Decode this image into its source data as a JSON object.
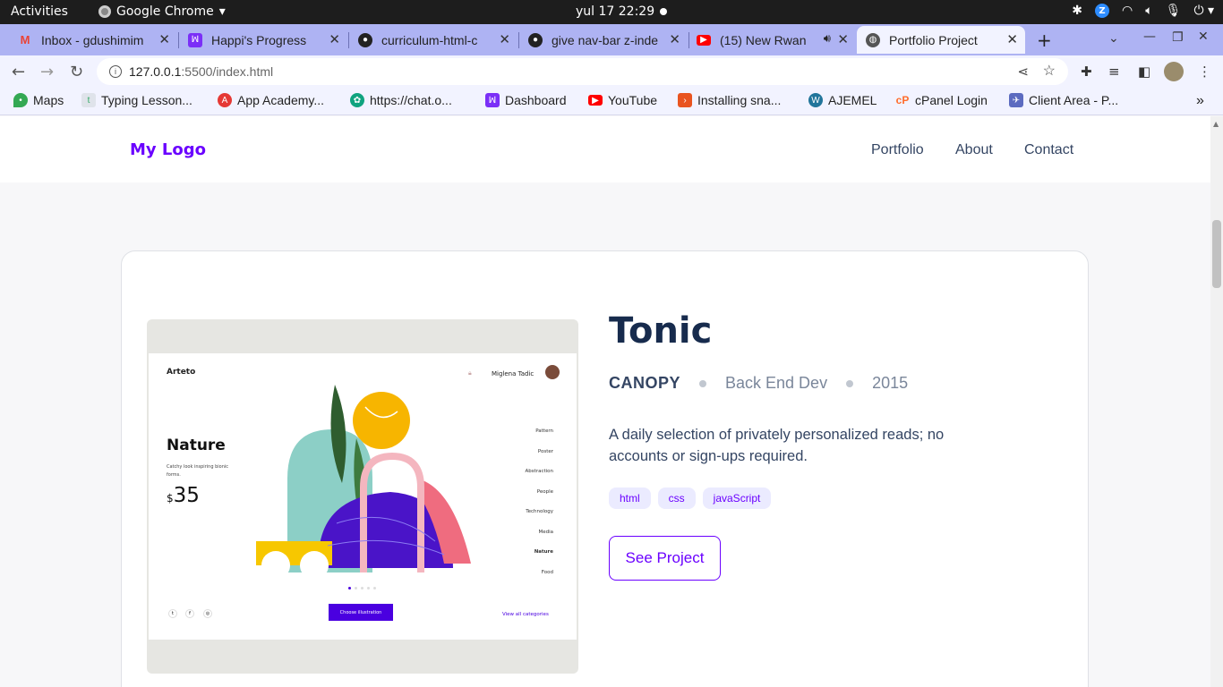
{
  "system": {
    "activities": "Activities",
    "app_name": "Google Chrome",
    "clock": "yul 17  22:29"
  },
  "tabs": [
    {
      "title": "Inbox - gdushimim",
      "favicon": "gmail-icon",
      "color": "#ea4335"
    },
    {
      "title": "Happi's Progress",
      "favicon": "microverse-icon",
      "color": "#7b2ff7"
    },
    {
      "title": "curriculum-html-c",
      "favicon": "github-icon",
      "color": "#222222"
    },
    {
      "title": "give nav-bar z-inde",
      "favicon": "github-icon",
      "color": "#222222"
    },
    {
      "title": "(15) New Rwan",
      "favicon": "youtube-icon",
      "color": "#ff0000"
    },
    {
      "title": "Portfolio Project",
      "favicon": "globe-icon",
      "color": "#444444",
      "active": true
    }
  ],
  "address_bar": {
    "host": "127.0.0.1",
    "path": ":5500/index.html"
  },
  "bookmarks": [
    {
      "label": "Maps",
      "icon": "maps-icon",
      "color": "#34a853"
    },
    {
      "label": "Typing Lesson...",
      "icon": "typing-icon",
      "color": "#9aa0a6"
    },
    {
      "label": "App Academy...",
      "icon": "app-academy-icon",
      "color": "#e53935"
    },
    {
      "label": "https://chat.o...",
      "icon": "chatgpt-icon",
      "color": "#10a37f"
    },
    {
      "label": "Dashboard",
      "icon": "microverse-icon",
      "color": "#7b2ff7"
    },
    {
      "label": "YouTube",
      "icon": "youtube-icon",
      "color": "#ff0000"
    },
    {
      "label": "Installing sna...",
      "icon": "snap-icon",
      "color": "#e95420"
    },
    {
      "label": "AJEMEL",
      "icon": "wordpress-icon",
      "color": "#21759b"
    },
    {
      "label": "cPanel Login",
      "icon": "cpanel-icon",
      "color": "#ff6c2c"
    },
    {
      "label": "Client Area - P...",
      "icon": "client-area-icon",
      "color": "#5c6bc0"
    }
  ],
  "site": {
    "logo": "My Logo",
    "nav": [
      "Portfolio",
      "About",
      "Contact"
    ]
  },
  "project": {
    "title": "Tonic",
    "client": "CANOPY",
    "role": "Back End Dev",
    "year": "2015",
    "description": "A daily selection of privately personalized reads; no accounts or sign-ups required.",
    "tags": [
      "html",
      "css",
      "javaScript"
    ],
    "button": "See Project"
  },
  "preview": {
    "brand": "Arteto",
    "user": "Miglena Tadic",
    "heading": "Nature",
    "subtitle": "Catchy look inspiring bionic forms.",
    "currency": "$",
    "price": "35",
    "categories": [
      "Pattern",
      "Poster",
      "Abstraction",
      "People",
      "Technology",
      "Media",
      "Nature",
      "Food"
    ],
    "cta": "Choose illustration",
    "view_all": "View all categories"
  },
  "colors": {
    "accent": "#6a00ff",
    "heading": "#172b4d",
    "tab_bar": "#aeb3f3"
  }
}
